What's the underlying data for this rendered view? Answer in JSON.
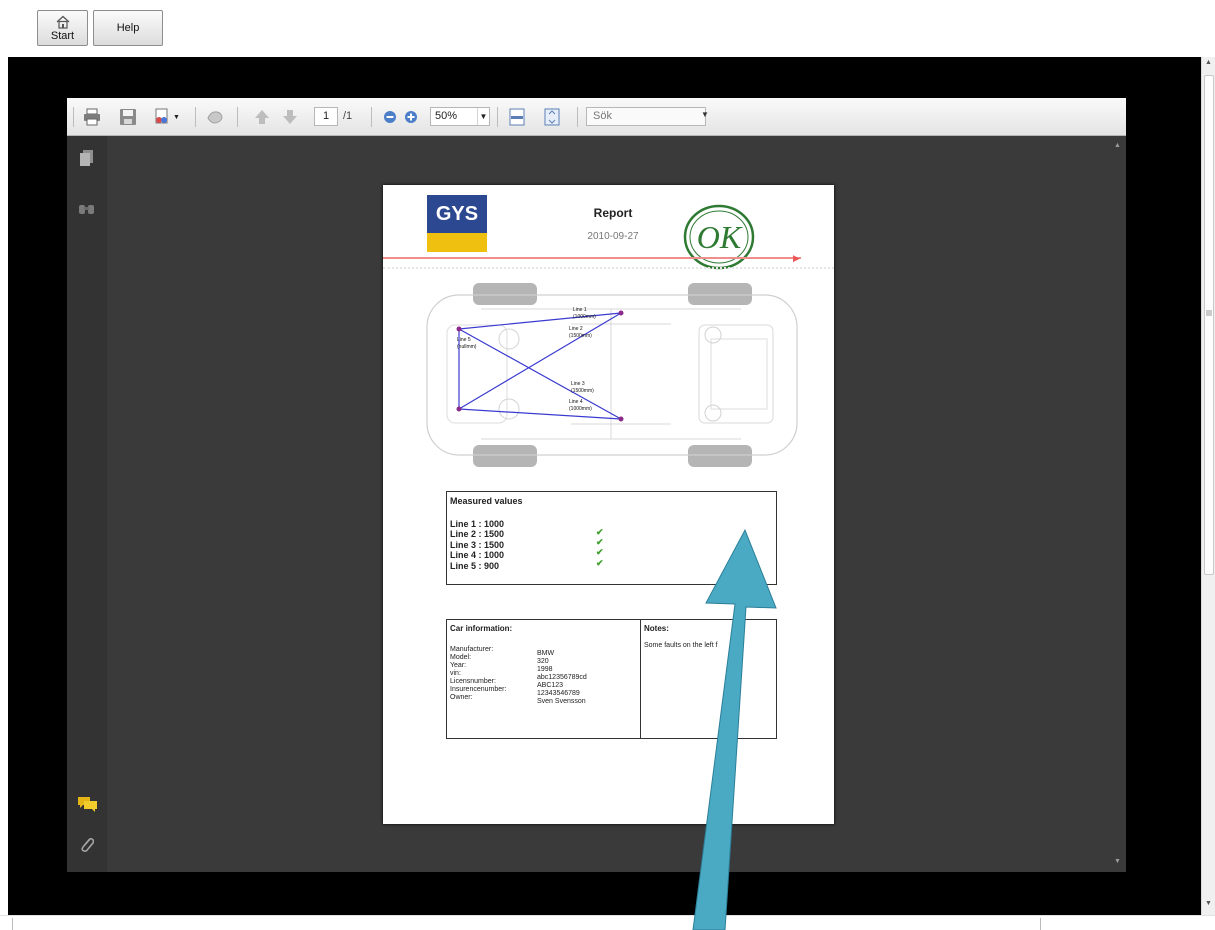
{
  "app": {
    "start_label": "Start",
    "help_label": "Help"
  },
  "pdf_toolbar": {
    "page_current": "1",
    "page_total": "/1",
    "zoom": "50%",
    "search_placeholder": "Sök"
  },
  "report": {
    "logo_text": "GYS",
    "title": "Report",
    "date": "2010-09-27",
    "stamp_text": "OK",
    "car_labels": {
      "line1": "Line 1",
      "line1_len": "(1000mm)",
      "line2": "Line 2",
      "line2_len": "(1500mm)",
      "line3": "Line 3",
      "line3_len": "(1500mm)",
      "line4": "Line 4",
      "line4_len": "(1000mm)",
      "line5": "Line 5",
      "line5_len": "(nullmm)"
    },
    "measured": {
      "title": "Measured values",
      "lines": [
        "Line 1 : 1000",
        "Line 2 : 1500",
        "Line 3 : 1500",
        "Line 4 : 1000",
        "Line 5 : 900"
      ],
      "check": "✔"
    },
    "car_info": {
      "title": "Car information:",
      "labels": [
        "Manufacturer:",
        "Model:",
        "Year:",
        "vin:",
        "Licensnumber:",
        "Insurencenumber:",
        "Owner:"
      ],
      "values": [
        "BMW",
        "320",
        "1998",
        "abc12356789cd",
        "ABC123",
        "12343546789",
        "Sven Svensson"
      ]
    },
    "notes": {
      "title": "Notes:",
      "text": "Some faults on the left f"
    }
  },
  "colors": {
    "arrow": "#4aaac4",
    "logo_blue": "#2b4890",
    "logo_yellow": "#f0c010",
    "stamp_green": "#2e7a33",
    "measure_line": "#3a3ad0",
    "check_green": "#3fa02d"
  }
}
